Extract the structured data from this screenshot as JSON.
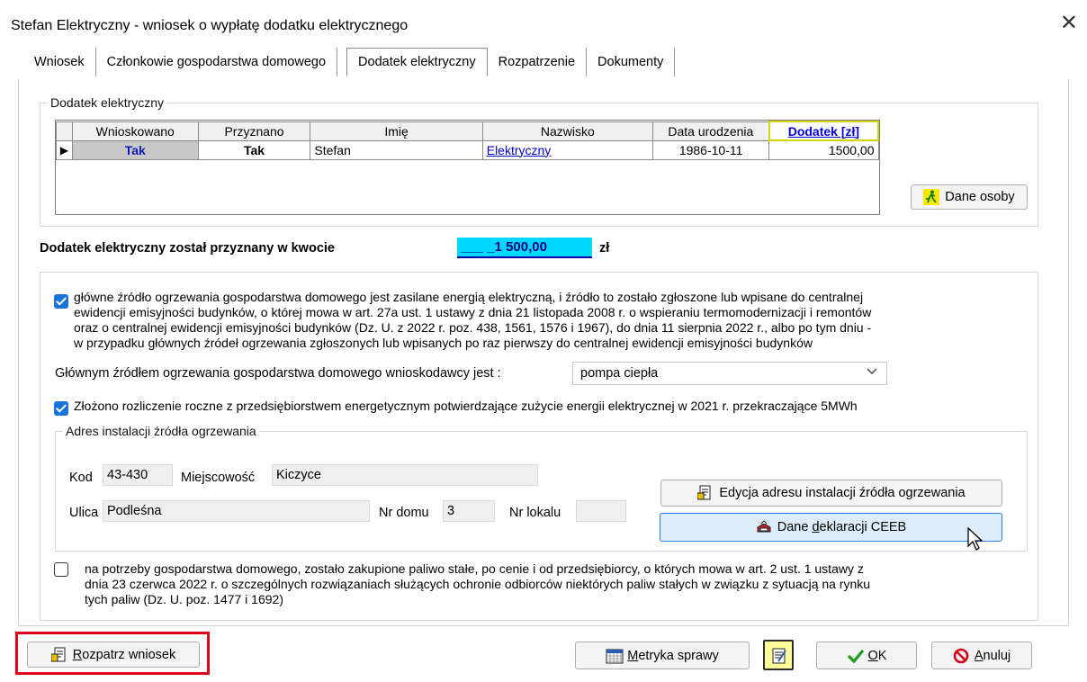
{
  "window": {
    "title": "Stefan Elektryczny - wniosek o wypłatę dodatku elektrycznego",
    "close_icon": "close-icon"
  },
  "tabs": [
    {
      "label": "Wniosek"
    },
    {
      "label": "Członkowie gospodarstwa domowego"
    },
    {
      "label": "Dodatek elektryczny",
      "active": true
    },
    {
      "label": "Rozpatrzenie"
    },
    {
      "label": "Dokumenty"
    }
  ],
  "group_title": "Dodatek elektryczny",
  "grid": {
    "headers": [
      "Wnioskowano",
      "Przyznano",
      "Imię",
      "Nazwisko",
      "Data urodzenia",
      "Dodatek [zł]"
    ],
    "rows": [
      {
        "wnioskowano": "Tak",
        "przyznano": "Tak",
        "imie": "Stefan",
        "nazwisko": "Elektryczny",
        "data_urodzenia": "1986-10-11",
        "dodatek": "1500,00"
      }
    ]
  },
  "dane_osoby_button": "Dane osoby",
  "award": {
    "label": "Dodatek elektryczny został przyznany w kwocie",
    "amount": "___ _1 500,00",
    "currency": "zł"
  },
  "checkbox_main": {
    "checked": true,
    "lines": [
      "główne źródło ogrzewania gospodarstwa domowego jest zasilane energią elektryczną, i źródło to zostało zgłoszone lub wpisane do centralnej",
      "ewidencji emisyjności budynków, o której mowa w art. 27a ust. 1 ustawy z dnia 21 listopada 2008 r. o wspieraniu termomodernizacji i remontów",
      "oraz o centralnej ewidencji emisyjności budynków (Dz. U. z 2022 r. poz. 438, 1561, 1576 i 1967), do dnia 11 sierpnia 2022 r., albo po tym dniu -",
      "w przypadku głównych źródeł ogrzewania zgłoszonych lub wpisanych po raz pierwszy do centralnej ewidencji emisyjności budynków"
    ]
  },
  "heating_source": {
    "label": "Głównym źródłem ogrzewania gospodarstwa domowego wnioskodawcy jest :",
    "value": "pompa ciepła"
  },
  "checkbox_settlement": {
    "checked": true,
    "label": "Złożono rozliczenie roczne z przedsiębiorstwem energetycznym potwierdzające zużycie energii elektrycznej w 2021 r. przekraczające 5MWh"
  },
  "address": {
    "title": "Adres instalacji źródła ogrzewania",
    "kod_label": "Kod",
    "kod": "43-430",
    "miejscowosc_label": "Miejscowość",
    "miejscowosc": "Kiczyce",
    "ulica_label": "Ulica",
    "ulica": "Podleśna",
    "nr_domu_label": "Nr domu",
    "nr_domu": "3",
    "nr_lokalu_label": "Nr lokalu",
    "nr_lokalu": "",
    "edit_button": "Edycja adresu instalacji źródła ogrzewania",
    "ceeb_button_pre": "Dane ",
    "ceeb_button_u": "d",
    "ceeb_button_post": "eklaracji CEEB"
  },
  "checkbox_fuel": {
    "checked": false,
    "lines": [
      "na potrzeby gospodarstwa domowego, zostało zakupione paliwo stałe, po cenie i od przedsiębiorcy, o których mowa w art. 2 ust. 1 ustawy z",
      "dnia 23 czerwca 2022 r. o szczególnych rozwiązaniach służących ochronie odbiorców niektórych paliw stałych w związku z sytuacją na rynku",
      "tych paliw (Dz. U. poz. 1477 i 1692)"
    ]
  },
  "footer": {
    "rozpatrz_u": "R",
    "rozpatrz_rest": "ozpatrz wniosek",
    "metryka_u": "M",
    "metryka_rest": "etryka sprawy",
    "ok_u": "O",
    "ok_rest": "K",
    "anuluj_u": "A",
    "anuluj_rest": "nuluj"
  },
  "colors": {
    "accent": "#1a73d9",
    "amount_bg": "#00d8ff",
    "highlight": "#e0001a"
  }
}
